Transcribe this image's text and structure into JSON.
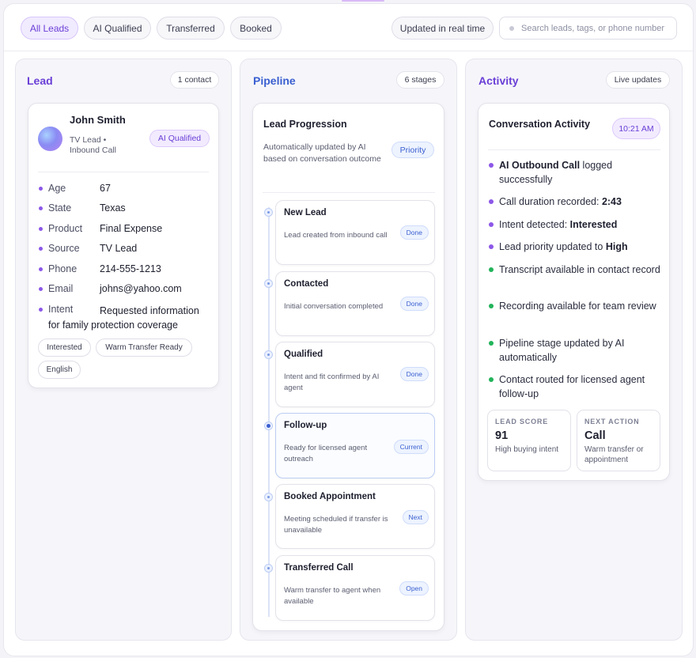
{
  "filters": [
    "All Leads",
    "AI Qualified",
    "Transferred",
    "Booked"
  ],
  "status_chip": "Updated in real time",
  "search": {
    "placeholder": "Search leads, tags, or phone number"
  },
  "lead_column": {
    "title": "Lead",
    "badge": "1 contact",
    "contact": {
      "name": "John Smith",
      "subtitle": "TV Lead • Inbound Call",
      "status": "AI Qualified",
      "fields": [
        {
          "label": "Age",
          "value": "67"
        },
        {
          "label": "State",
          "value": "Texas"
        },
        {
          "label": "Product",
          "value": "Final Expense"
        },
        {
          "label": "Source",
          "value": "TV Lead"
        },
        {
          "label": "Phone",
          "value": "214-555-1213"
        },
        {
          "label": "Email",
          "value": "johns@yahoo.com"
        },
        {
          "label": "Intent",
          "value": "Requested information for family protection coverage"
        }
      ],
      "tags": [
        "Interested",
        "Warm Transfer Ready",
        "English"
      ]
    }
  },
  "pipeline_column": {
    "title": "Pipeline",
    "badge": "6 stages",
    "card_title": "Lead Progression",
    "card_desc": "Automatically updated by AI based on conversation outcome",
    "priority": "Priority",
    "stages": [
      {
        "title": "New Lead",
        "desc": "Lead created from inbound call",
        "status": "Done"
      },
      {
        "title": "Contacted",
        "desc": "Initial conversation completed",
        "status": "Done"
      },
      {
        "title": "Qualified",
        "desc": "Intent and fit confirmed by AI agent",
        "status": "Done"
      },
      {
        "title": "Follow-up",
        "desc": "Ready for licensed agent outreach",
        "status": "Current"
      },
      {
        "title": "Booked Appointment",
        "desc": "Meeting scheduled if transfer is unavailable",
        "status": "Next"
      },
      {
        "title": "Transferred Call",
        "desc": "Warm transfer to agent when available",
        "status": "Open"
      }
    ]
  },
  "activity_column": {
    "title": "Activity",
    "badge": "Live updates",
    "card_title": "Conversation Activity",
    "time": "10:21 AM",
    "colors": {
      "purple": "#8c57e8",
      "green": "#22b35a"
    },
    "items": [
      {
        "bold": "AI Outbound Call",
        "text": " logged successfully",
        "bold_first": true,
        "color": "purple"
      },
      {
        "text": "Call duration recorded: ",
        "bold": "2:43",
        "bold_first": false,
        "color": "purple"
      },
      {
        "text": "Intent detected: ",
        "bold": "Interested",
        "bold_first": false,
        "color": "purple"
      },
      {
        "text": "Lead priority updated to ",
        "bold": "High",
        "bold_first": false,
        "color": "purple"
      },
      {
        "text": "Transcript available in contact record",
        "bold": "",
        "bold_first": false,
        "color": "green"
      },
      {
        "text": "Recording available for team review",
        "bold": "",
        "bold_first": false,
        "color": "green"
      },
      {
        "text": "Pipeline stage updated by AI automatically",
        "bold": "",
        "bold_first": false,
        "color": "green"
      },
      {
        "text": "Contact routed for licensed agent follow-up",
        "bold": "",
        "bold_first": false,
        "color": "green"
      }
    ],
    "lead_score": {
      "label": "LEAD SCORE",
      "value": "91",
      "note": "High buying intent"
    },
    "next_action": {
      "label": "NEXT ACTION",
      "value": "Call",
      "note": "Warm transfer or appointment"
    }
  }
}
